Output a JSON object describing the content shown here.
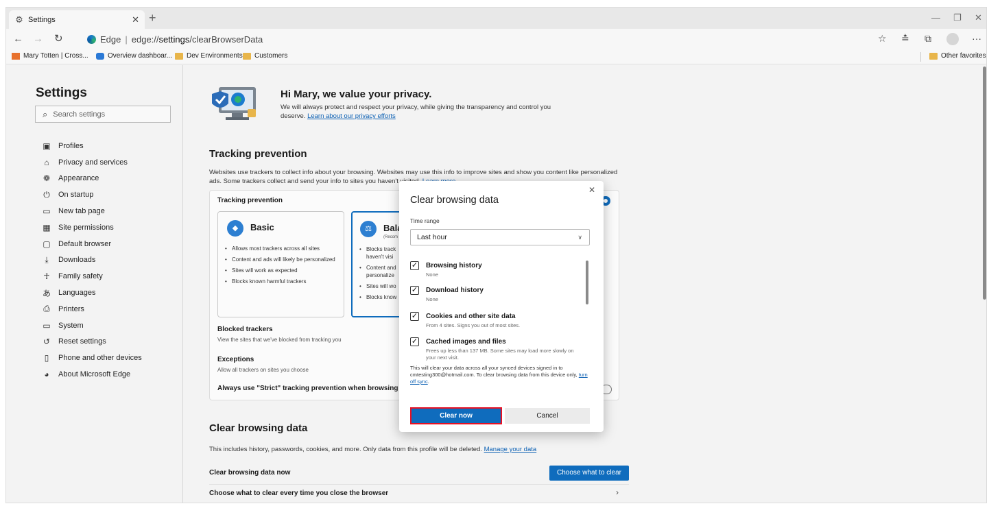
{
  "browser": {
    "tab_title": "Settings",
    "address_brand": "Edge",
    "address_prefix": "edge://",
    "address_bold": "settings",
    "address_suffix": "/clearBrowserData",
    "favorites": [
      {
        "label": "Mary Totten | Cross...",
        "icon": "app-icon"
      },
      {
        "label": "Overview dashboar...",
        "icon": "dashboard-icon"
      },
      {
        "label": "Dev Environments",
        "icon": "folder-icon"
      },
      {
        "label": "Customers",
        "icon": "folder-icon"
      }
    ],
    "other_favorites": "Other favorites"
  },
  "sidebar": {
    "title": "Settings",
    "search_placeholder": "Search settings",
    "items": [
      {
        "label": "Profiles",
        "icon": "profile-icon"
      },
      {
        "label": "Privacy and services",
        "icon": "lock-icon"
      },
      {
        "label": "Appearance",
        "icon": "palette-icon"
      },
      {
        "label": "On startup",
        "icon": "power-icon"
      },
      {
        "label": "New tab page",
        "icon": "newtab-icon"
      },
      {
        "label": "Site permissions",
        "icon": "permissions-icon"
      },
      {
        "label": "Default browser",
        "icon": "browser-icon"
      },
      {
        "label": "Downloads",
        "icon": "download-icon"
      },
      {
        "label": "Family safety",
        "icon": "family-icon"
      },
      {
        "label": "Languages",
        "icon": "language-icon"
      },
      {
        "label": "Printers",
        "icon": "printer-icon"
      },
      {
        "label": "System",
        "icon": "system-icon"
      },
      {
        "label": "Reset settings",
        "icon": "reset-icon"
      },
      {
        "label": "Phone and other devices",
        "icon": "phone-icon"
      },
      {
        "label": "About Microsoft Edge",
        "icon": "edge-icon"
      }
    ]
  },
  "hero": {
    "title": "Hi Mary, we value your privacy.",
    "text": "We will always protect and respect your privacy, while giving the transparency and control you deserve.",
    "link": "Learn about our privacy efforts"
  },
  "tracking": {
    "heading": "Tracking prevention",
    "description": "Websites use trackers to collect info about your browsing. Websites may use this info to improve sites and show you content like personalized ads. Some trackers collect and send your info to sites you haven't visited.",
    "learn_more": "Learn more",
    "card_title": "Tracking prevention",
    "basic": {
      "name": "Basic",
      "bullets": [
        "Allows most trackers across all sites",
        "Content and ads will likely be personalized",
        "Sites will work as expected",
        "Blocks known harmful trackers"
      ]
    },
    "balanced": {
      "name": "Bala",
      "sub": "(Recom",
      "bullets": [
        "Blocks track haven't visi",
        "Content and personalize",
        "Sites will wo",
        "Blocks know"
      ]
    },
    "blocked_title": "Blocked trackers",
    "blocked_desc": "View the sites that we've blocked from tracking you",
    "exceptions_title": "Exceptions",
    "exceptions_desc": "Allow all trackers on sites you choose",
    "strict_label": "Always use \"Strict\" tracking prevention when browsing I"
  },
  "clear_section": {
    "heading": "Clear browsing data",
    "description": "This includes history, passwords, cookies, and more. Only data from this profile will be deleted.",
    "manage_link": "Manage your data",
    "clear_now_label": "Clear browsing data now",
    "choose_button": "Choose what to clear",
    "choose_every_time": "Choose what to clear every time you close the browser"
  },
  "dialog": {
    "title": "Clear browsing data",
    "time_range_label": "Time range",
    "time_range_value": "Last hour",
    "options": [
      {
        "label": "Browsing history",
        "desc": "None",
        "checked": true
      },
      {
        "label": "Download history",
        "desc": "None",
        "checked": true
      },
      {
        "label": "Cookies and other site data",
        "desc": "From 4 sites. Signs you out of most sites.",
        "checked": true
      },
      {
        "label": "Cached images and files",
        "desc": "Frees up less than 137 MB. Some sites may load more slowly on your next visit.",
        "checked": true
      }
    ],
    "note": "This will clear your data across all your synced devices signed in to cmtesting300@hotmail.com. To clear browsing data from this device only,",
    "note_link": "turn off sync",
    "clear_button": "Clear now",
    "cancel_button": "Cancel"
  }
}
